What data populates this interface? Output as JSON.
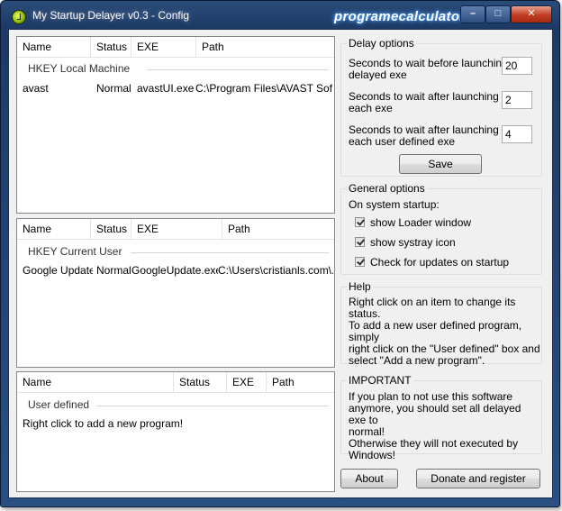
{
  "window": {
    "title": "My Startup Delayer v0.3 - Config",
    "watermark": "programecalculator.ro",
    "controls": {
      "minimize": "–",
      "maximize": "□",
      "close": "✕"
    }
  },
  "lists": {
    "local_machine": {
      "columns": [
        "Name",
        "Status",
        "EXE",
        "Path"
      ],
      "group": "HKEY Local Machine",
      "rows": [
        {
          "name": "avast",
          "status": "Normal",
          "exe": "avastUI.exe",
          "path": "C:\\Program Files\\AVAST Soft..."
        }
      ]
    },
    "current_user": {
      "columns": [
        "Name",
        "Status",
        "EXE",
        "Path"
      ],
      "group": "HKEY Current User",
      "rows": [
        {
          "name": "Google Update",
          "status": "Normal",
          "exe": "GoogleUpdate.exe",
          "path": "C:\\Users\\cristianls.com\\..."
        }
      ]
    },
    "user_defined": {
      "columns": [
        "Name",
        "Status",
        "EXE",
        "Path"
      ],
      "group": "User defined",
      "hint": "Right click to add a new program!"
    }
  },
  "delay_options": {
    "title": "Delay options",
    "fields": [
      {
        "line1": "Seconds to wait before launching",
        "line2": "delayed exe",
        "value": "20"
      },
      {
        "line1": "Seconds to wait after launching",
        "line2": "each exe",
        "value": "2"
      },
      {
        "line1": "Seconds to wait after launching",
        "line2": "each user defined exe",
        "value": "4"
      }
    ],
    "save_label": "Save"
  },
  "general_options": {
    "title": "General options",
    "subtitle": "On system startup:",
    "checkboxes": [
      {
        "label": "show Loader window",
        "checked": true
      },
      {
        "label": "show systray icon",
        "checked": true
      },
      {
        "label": "Check for updates on startup",
        "checked": true
      }
    ]
  },
  "help": {
    "title": "Help",
    "line1": "Right click on an item to change its status.",
    "line2": "To add a new user defined program, simply",
    "line3": "right click on the \"User defined\" box and",
    "line4": "select \"Add a new program\"."
  },
  "important": {
    "title": "IMPORTANT",
    "line1": "If you plan to not use this software",
    "line2": "anymore, you should set all delayed exe to",
    "line3": "normal!",
    "line4": "Otherwise they will not executed by",
    "line5": "Windows!"
  },
  "footer": {
    "about_label": "About",
    "donate_label": "Donate and register"
  }
}
